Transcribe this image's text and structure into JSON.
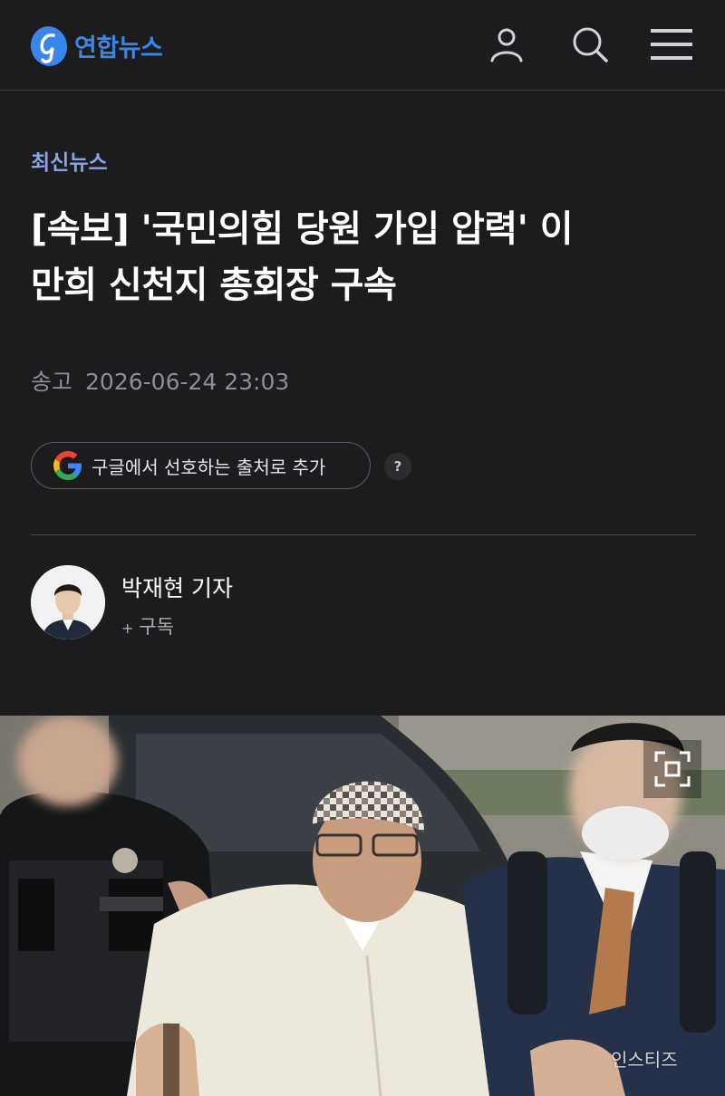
{
  "header": {
    "logo_text": "연합뉴스",
    "icons": [
      "user-icon",
      "search-icon",
      "menu-icon"
    ],
    "brand_color": "#3a86e8"
  },
  "article": {
    "category": "최신뉴스",
    "headline_line1": "[속보] '국민의힘 당원 가입 압력' 이",
    "headline_line2": "만희 신천지 총회장 구속",
    "sent_label": "송고",
    "sent_time": "2026-06-24 23:03",
    "google_button_label": "구글에서 선호하는 출처로 추가",
    "help_label": "?"
  },
  "reporter": {
    "name": "박재현 기자",
    "subscribe_plus": "+",
    "subscribe_label": "구독"
  },
  "photo": {
    "watermark": "인스티즈",
    "expand_icon": "expand-icon"
  },
  "colors": {
    "background": "#1c1c1e",
    "category": "#8aa4e6",
    "muted": "#8e8e93"
  }
}
